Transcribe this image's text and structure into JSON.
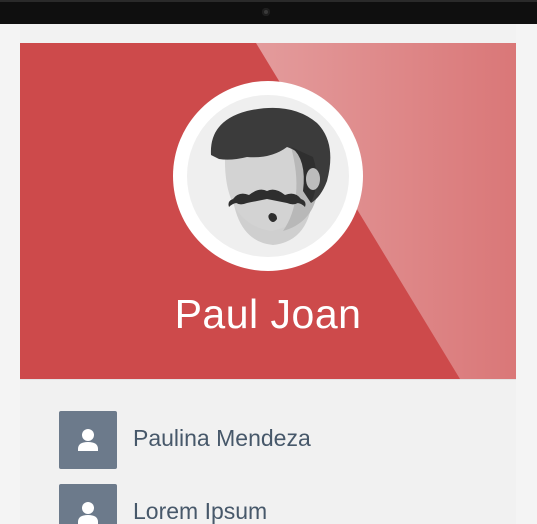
{
  "profile": {
    "name": "Paul Joan",
    "avatar_icon": "mustache-man-avatar-icon"
  },
  "contacts": [
    {
      "label": "Paulina Mendeza",
      "icon": "user-icon"
    },
    {
      "label": "Lorem Ipsum",
      "icon": "user-icon"
    }
  ],
  "colors": {
    "header_red": "#cd4a4b",
    "icon_tile": "#6c7a8b",
    "label_text": "#47586a",
    "device_bezel": "#0f0f0f"
  }
}
